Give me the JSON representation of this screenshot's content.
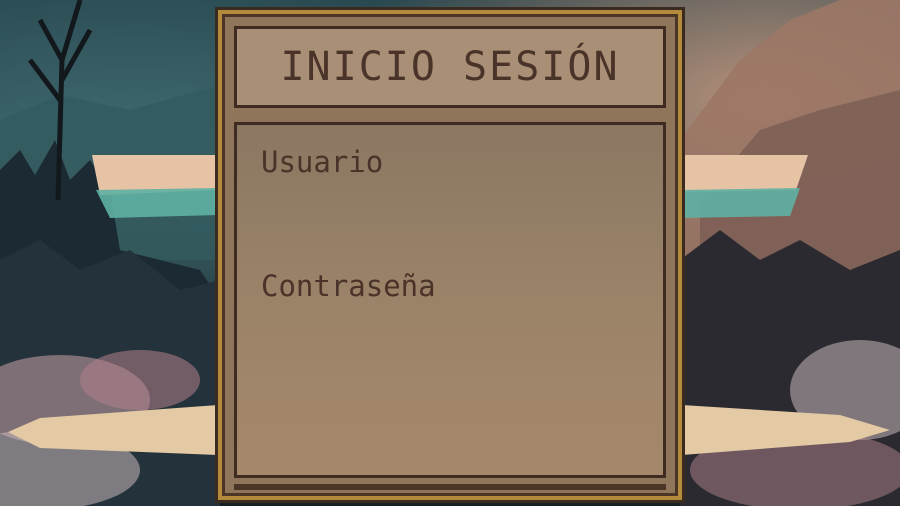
{
  "login": {
    "title": "INICIO SESIÓN",
    "username_label": "Usuario",
    "username_value": "",
    "password_label": "Contraseña",
    "password_value": ""
  },
  "colors": {
    "panel_fill": "#8f7559",
    "panel_border": "#b48a3c",
    "title_fill": "#a88f76",
    "text": "#4a3328"
  }
}
